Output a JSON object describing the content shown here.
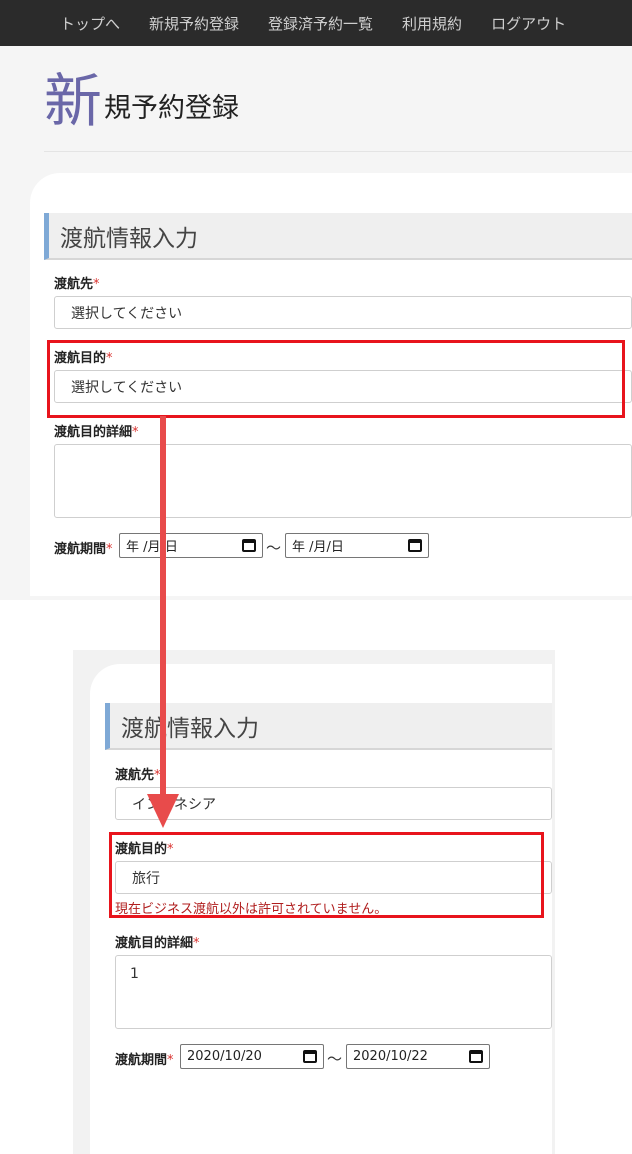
{
  "nav": {
    "items": [
      "トップへ",
      "新規予約登録",
      "登録済予約一覧",
      "利用規約",
      "ログアウト"
    ]
  },
  "page": {
    "title_first_char": "新",
    "title_rest": "規予約登録"
  },
  "form_before": {
    "section_title": "渡航情報入力",
    "destination_label": "渡航先",
    "destination_value": "選択してください",
    "purpose_label": "渡航目的",
    "purpose_value": "選択してください",
    "purpose_detail_label": "渡航目的詳細",
    "purpose_detail_value": "",
    "period_label": "渡航期間",
    "period_from": "年 /月/日",
    "period_to": "年 /月/日",
    "required_mark": "*",
    "tilde": "～"
  },
  "form_after": {
    "section_title": "渡航情報入力",
    "destination_label": "渡航先",
    "destination_value": "インドネシア",
    "purpose_label": "渡航目的",
    "purpose_value": "旅行",
    "purpose_error": "現在ビジネス渡航以外は許可されていません。",
    "purpose_detail_label": "渡航目的詳細",
    "purpose_detail_value": "1",
    "period_label": "渡航期間",
    "period_from": "2020/10/20",
    "period_to": "2020/10/22",
    "required_mark": "*",
    "tilde": "～"
  },
  "colors": {
    "highlight": "#e8141c",
    "arrow": "#e84b4b",
    "accent_title": "#6a67a8",
    "section_border": "#7fa9d6"
  }
}
